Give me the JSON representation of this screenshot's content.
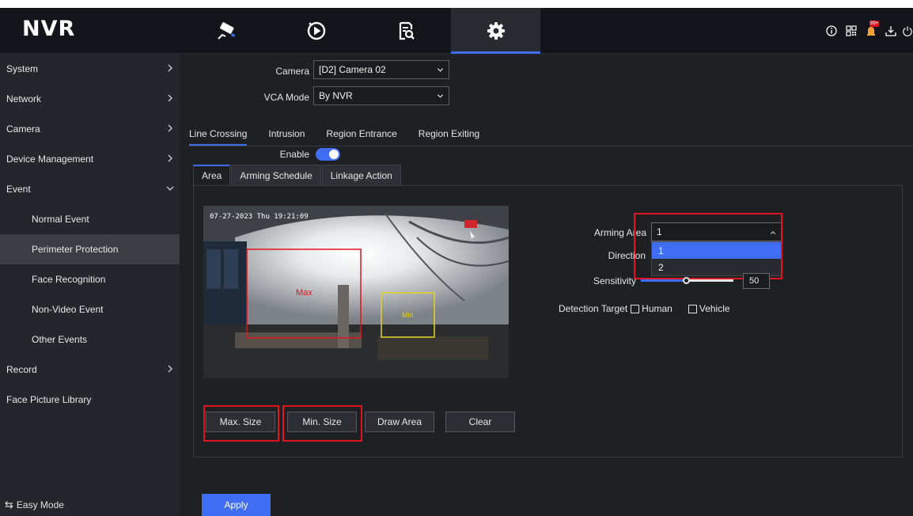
{
  "app": {
    "logo": "NVR",
    "nav_tabs": [
      {
        "icon": "camera-icon",
        "active": false
      },
      {
        "icon": "playback-icon",
        "active": false
      },
      {
        "icon": "search-file-icon",
        "active": false
      },
      {
        "icon": "gear-icon",
        "active": true
      }
    ],
    "top_right_icons": [
      "info-icon",
      "qr-code-icon",
      "alarm-icon",
      "download-icon",
      "power-icon"
    ],
    "alarm_badge": "99+"
  },
  "sidebar": {
    "items": [
      {
        "label": "System",
        "chevron": "right"
      },
      {
        "label": "Network",
        "chevron": "right"
      },
      {
        "label": "Camera",
        "chevron": "right"
      },
      {
        "label": "Device Management",
        "chevron": "right"
      },
      {
        "label": "Event",
        "chevron": "down"
      },
      {
        "label": "Normal Event",
        "sub": true
      },
      {
        "label": "Perimeter Protection",
        "sub": true,
        "selected": true
      },
      {
        "label": "Face Recognition",
        "sub": true
      },
      {
        "label": "Non-Video Event",
        "sub": true
      },
      {
        "label": "Other Events",
        "sub": true
      },
      {
        "label": "Record",
        "chevron": "right"
      },
      {
        "label": "Face Picture Library"
      }
    ],
    "easy_mode": "Easy Mode"
  },
  "main": {
    "camera_label": "Camera",
    "camera_value": "[D2] Camera 02",
    "vca_label": "VCA Mode",
    "vca_value": "By NVR",
    "event_tabs": [
      "Line Crossing",
      "Intrusion",
      "Region Entrance",
      "Region Exiting"
    ],
    "enable_label": "Enable",
    "enable_on": true,
    "sub_tabs": [
      "Area",
      "Arming Schedule",
      "Linkage Action"
    ],
    "timestamp": "07-27-2023 Thu 19:21:09",
    "max_box_label": "Max",
    "min_box_label": "Min",
    "buttons": {
      "max_size": "Max. Size",
      "min_size": "Min. Size",
      "draw_area": "Draw Area",
      "clear": "Clear"
    },
    "arming_area_label": "Arming Area",
    "arming_area_value": "1",
    "arming_area_options": [
      "1",
      "2"
    ],
    "direction_label": "Direction",
    "sensitivity_label": "Sensitivity",
    "sensitivity_value": "50",
    "detection_target_label": "Detection Target",
    "target_human": "Human",
    "target_vehicle": "Vehicle",
    "apply": "Apply"
  },
  "colors": {
    "accent": "#3f6df4",
    "highlight": "#e0141e",
    "sidebar_bg": "#25262b",
    "main_bg": "#1f2024"
  }
}
